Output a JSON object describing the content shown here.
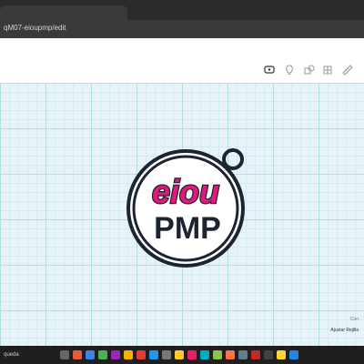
{
  "browser": {
    "url": "qM07-eioupmp/edit"
  },
  "toolbar": {
    "icons": [
      "annotate-icon",
      "light-icon",
      "shapes-icon",
      "grid-icon",
      "ruler-icon"
    ]
  },
  "viewport": {
    "grid_label": "Ajustar Rejilla",
    "mini_label": "Con"
  },
  "design": {
    "top_text": "eiou",
    "bottom_text": "PMP",
    "colors": {
      "outline": "#1c2430",
      "pink": "#e0197d",
      "white": "#ffffff",
      "grid_bg": "#e7f3f7",
      "grid_major": "#b6dce7",
      "grid_minor": "#d3ebf2"
    }
  },
  "taskbar": {
    "search_label": "queda"
  }
}
